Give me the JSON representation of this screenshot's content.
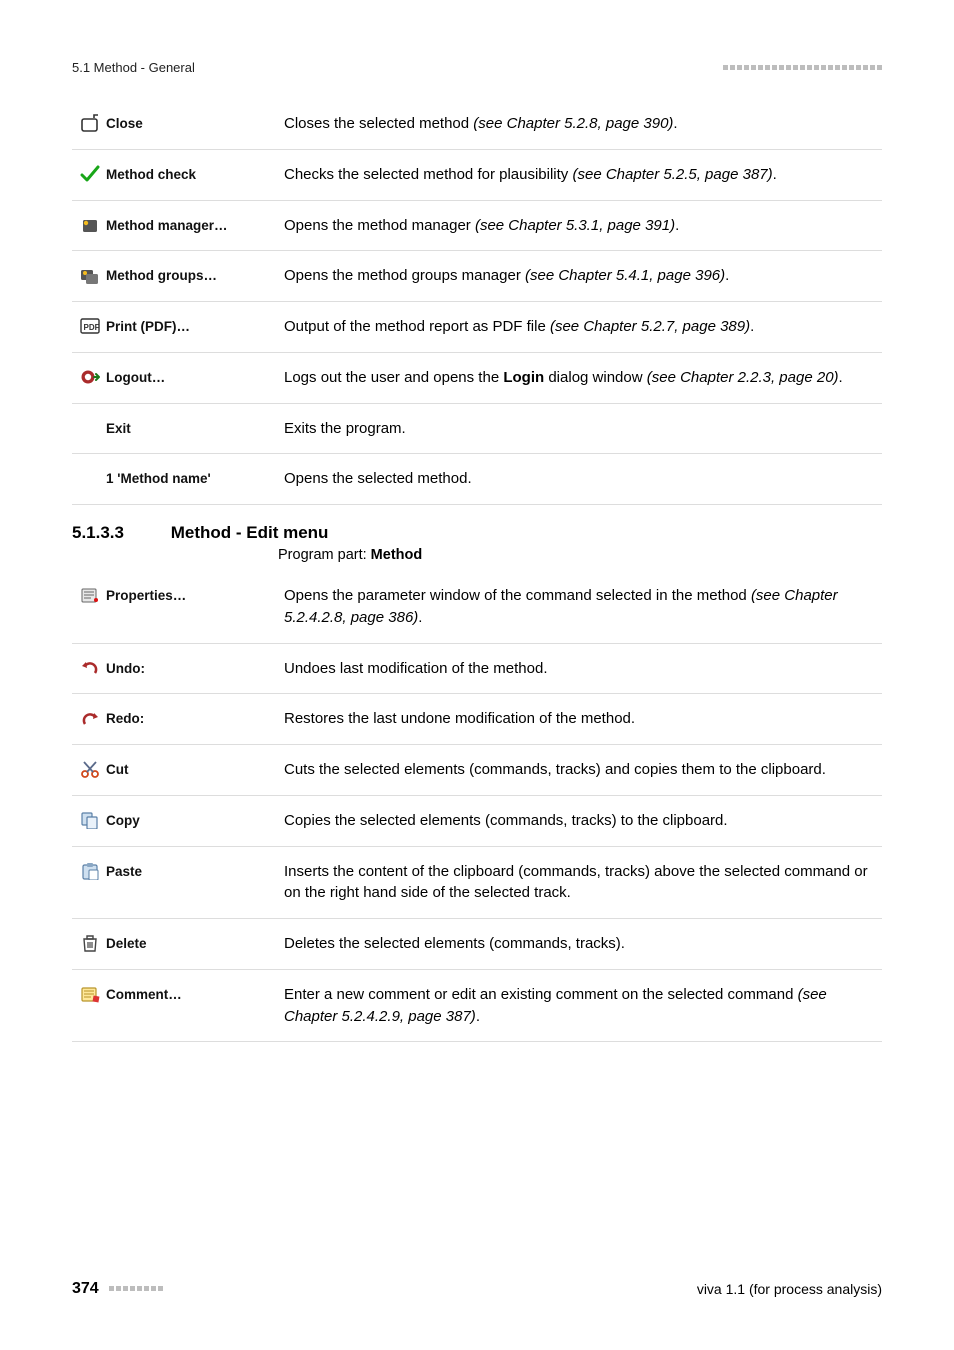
{
  "header": {
    "section_label": "5.1 Method - General"
  },
  "table1": {
    "rows": [
      {
        "icon": "close-icon",
        "label": "Close",
        "desc_pre": "Closes the selected method ",
        "desc_em": "(see Chapter 5.2.8, page 390)",
        "desc_post": "."
      },
      {
        "icon": "check-icon",
        "label": "Method check",
        "desc_pre": "Checks the selected method for plausibility ",
        "desc_em": "(see Chapter 5.2.5, page 387)",
        "desc_post": "."
      },
      {
        "icon": "method-manager-icon",
        "label": "Method manager…",
        "desc_pre": "Opens the method manager ",
        "desc_em": "(see Chapter 5.3.1, page 391)",
        "desc_post": "."
      },
      {
        "icon": "method-groups-icon",
        "label": "Method groups…",
        "desc_pre": "Opens the method groups manager ",
        "desc_em": "(see Chapter 5.4.1, page 396)",
        "desc_post": "."
      },
      {
        "icon": "pdf-icon",
        "label": "Print (PDF)…",
        "desc_pre": "Output of the method report as PDF file ",
        "desc_em": "(see Chapter 5.2.7, page 389)",
        "desc_post": "."
      },
      {
        "icon": "logout-icon",
        "label": "Logout…",
        "desc_pre": "Logs out the user and opens the ",
        "desc_bold": "Login",
        "desc_mid": " dialog window ",
        "desc_em": "(see Chapter 2.2.3, page 20)",
        "desc_post": "."
      },
      {
        "icon": "",
        "label": "Exit",
        "desc_pre": "Exits the program.",
        "desc_em": "",
        "desc_post": ""
      },
      {
        "icon": "",
        "label": "1 'Method name'",
        "desc_pre": "Opens the selected method.",
        "desc_em": "",
        "desc_post": ""
      }
    ]
  },
  "section": {
    "number": "5.1.3.3",
    "title": "Method - Edit menu",
    "program_part_label": "Program part: ",
    "program_part_value": "Method"
  },
  "table2": {
    "rows": [
      {
        "icon": "properties-icon",
        "label": "Properties…",
        "desc_pre": "Opens the parameter window of the command selected in the method ",
        "desc_em": "(see Chapter 5.2.4.2.8, page 386)",
        "desc_post": "."
      },
      {
        "icon": "undo-icon",
        "label": "Undo:",
        "desc_pre": "Undoes last modification of the method.",
        "desc_em": "",
        "desc_post": ""
      },
      {
        "icon": "redo-icon",
        "label": "Redo:",
        "desc_pre": "Restores the last undone modification of the method.",
        "desc_em": "",
        "desc_post": ""
      },
      {
        "icon": "cut-icon",
        "label": "Cut",
        "desc_pre": "Cuts the selected elements (commands, tracks) and copies them to the clipboard.",
        "desc_em": "",
        "desc_post": ""
      },
      {
        "icon": "copy-icon",
        "label": "Copy",
        "desc_pre": "Copies the selected elements (commands, tracks) to the clipboard.",
        "desc_em": "",
        "desc_post": ""
      },
      {
        "icon": "paste-icon",
        "label": "Paste",
        "desc_pre": "Inserts the content of the clipboard (commands, tracks) above the selected command or on the right hand side of the selected track.",
        "desc_em": "",
        "desc_post": ""
      },
      {
        "icon": "delete-icon",
        "label": "Delete",
        "desc_pre": "Deletes the selected elements (commands, tracks).",
        "desc_em": "",
        "desc_post": ""
      },
      {
        "icon": "comment-icon",
        "label": "Comment…",
        "desc_pre": "Enter a new comment or edit an existing comment on the selected command ",
        "desc_em": "(see Chapter 5.2.4.2.9, page 387)",
        "desc_post": "."
      }
    ]
  },
  "footer": {
    "page_number": "374",
    "product": "viva 1.1 (for process analysis)"
  }
}
